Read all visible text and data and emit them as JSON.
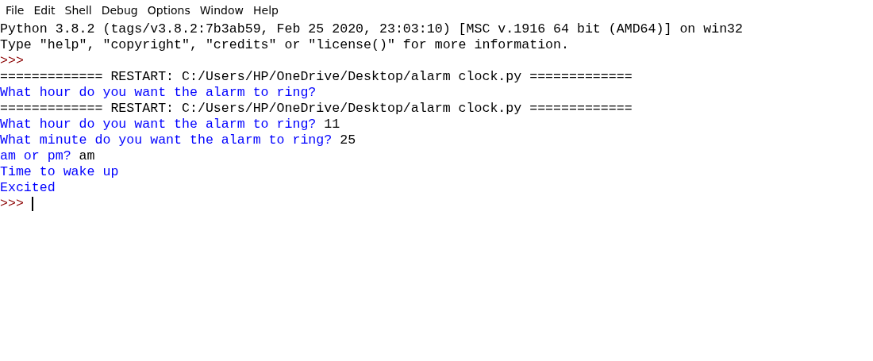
{
  "menu": [
    "File",
    "Edit",
    "Shell",
    "Debug",
    "Options",
    "Window",
    "Help"
  ],
  "lines": [
    {
      "segments": [
        {
          "kind": "output",
          "text": "Python 3.8.2 (tags/v3.8.2:7b3ab59, Feb 25 2020, 23:03:10) [MSC v.1916 64 bit (AMD64)] on win32"
        }
      ]
    },
    {
      "segments": [
        {
          "kind": "output",
          "text": "Type \"help\", \"copyright\", \"credits\" or \"license()\" for more information."
        }
      ]
    },
    {
      "segments": [
        {
          "kind": "prompt",
          "text": ">>>"
        }
      ]
    },
    {
      "segments": [
        {
          "kind": "output",
          "text": "============= RESTART: C:/Users/HP/OneDrive/Desktop/alarm clock.py ============="
        }
      ]
    },
    {
      "segments": [
        {
          "kind": "stdout",
          "text": "What hour do you want the alarm to ring?"
        }
      ]
    },
    {
      "segments": [
        {
          "kind": "output",
          "text": "============= RESTART: C:/Users/HP/OneDrive/Desktop/alarm clock.py ============="
        }
      ]
    },
    {
      "segments": [
        {
          "kind": "stdout",
          "text": "What hour do you want the alarm to ring?"
        },
        {
          "kind": "input",
          "text": "11"
        }
      ]
    },
    {
      "segments": [
        {
          "kind": "stdout",
          "text": "What minute do you want the alarm to ring?"
        },
        {
          "kind": "input",
          "text": "25"
        }
      ]
    },
    {
      "segments": [
        {
          "kind": "stdout",
          "text": "am or pm?"
        },
        {
          "kind": "input",
          "text": "am"
        }
      ]
    },
    {
      "segments": [
        {
          "kind": "stdout",
          "text": "Time to wake up"
        }
      ]
    },
    {
      "segments": [
        {
          "kind": "stdout",
          "text": "Excited"
        }
      ]
    },
    {
      "segments": [
        {
          "kind": "prompt",
          "text": ">>>"
        }
      ],
      "cursor": true
    }
  ]
}
